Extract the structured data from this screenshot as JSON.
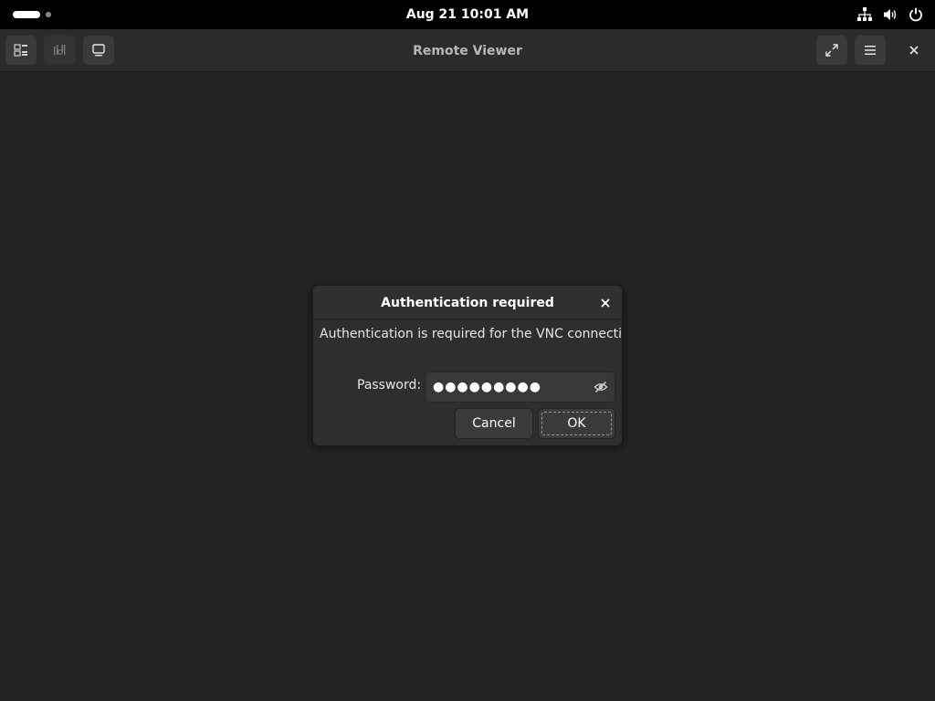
{
  "system_bar": {
    "clock": "Aug 21  10:01 AM",
    "tray_icons": [
      "network-icon",
      "volume-icon",
      "power-icon"
    ]
  },
  "window": {
    "title": "Remote Viewer",
    "left_buttons": [
      "display-switch-icon",
      "usb-redirect-icon",
      "screen-icon"
    ],
    "right_buttons": [
      "fullscreen-icon",
      "hamburger-menu-icon",
      "close-icon"
    ]
  },
  "dialog": {
    "title": "Authentication required",
    "message": "Authentication is required for the VNC connection:",
    "password_label": "Password:",
    "password_value": "●●●●●●●●●",
    "cancel_label": "Cancel",
    "ok_label": "OK"
  },
  "colors": {
    "background": "#242424",
    "topbar": "#000000",
    "headerbar": "#2b2b2b",
    "dialog": "#2e2e2e",
    "button": "#3b3b3b"
  }
}
